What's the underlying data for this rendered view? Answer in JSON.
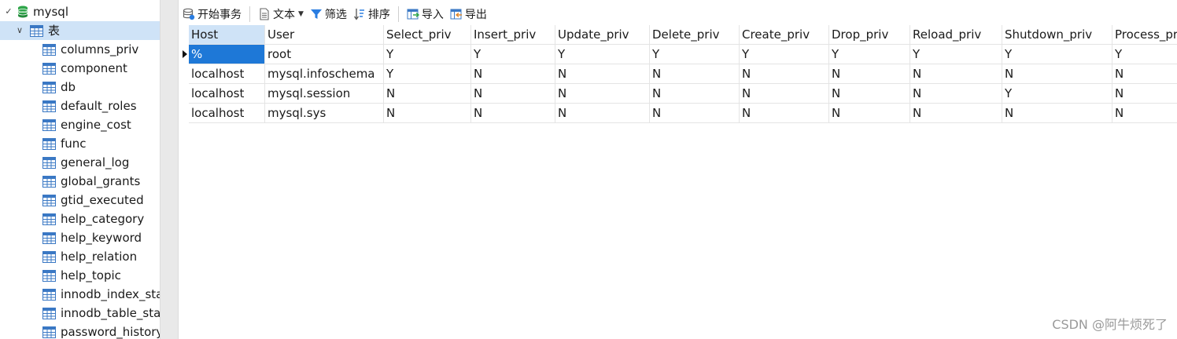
{
  "sidebar": {
    "database": "mysql",
    "tables_node": "表",
    "tables": [
      "columns_priv",
      "component",
      "db",
      "default_roles",
      "engine_cost",
      "func",
      "general_log",
      "global_grants",
      "gtid_executed",
      "help_category",
      "help_keyword",
      "help_relation",
      "help_topic",
      "innodb_index_sta",
      "innodb_table_sta",
      "password_history"
    ]
  },
  "toolbar": {
    "begin_transaction": "开始事务",
    "text": "文本",
    "filter": "筛选",
    "sort": "排序",
    "import": "导入",
    "export": "导出"
  },
  "grid": {
    "columns": [
      "Host",
      "User",
      "Select_priv",
      "Insert_priv",
      "Update_priv",
      "Delete_priv",
      "Create_priv",
      "Drop_priv",
      "Reload_priv",
      "Shutdown_priv",
      "Process_pr"
    ],
    "rows": [
      [
        "%",
        "root",
        "Y",
        "Y",
        "Y",
        "Y",
        "Y",
        "Y",
        "Y",
        "Y",
        "Y"
      ],
      [
        "localhost",
        "mysql.infoschema",
        "Y",
        "N",
        "N",
        "N",
        "N",
        "N",
        "N",
        "N",
        "N"
      ],
      [
        "localhost",
        "mysql.session",
        "N",
        "N",
        "N",
        "N",
        "N",
        "N",
        "N",
        "Y",
        "N"
      ],
      [
        "localhost",
        "mysql.sys",
        "N",
        "N",
        "N",
        "N",
        "N",
        "N",
        "N",
        "N",
        "N"
      ]
    ]
  },
  "watermark": "CSDN @阿牛烦死了",
  "colors": {
    "selection": "#1e78d7",
    "header_active": "#cfe3f7",
    "db_icon": "#2fa64a",
    "table_icon": "#3a78c4"
  },
  "icons": [
    "database-icon",
    "table-icon",
    "transaction-icon",
    "text-icon",
    "filter-icon",
    "sort-icon",
    "import-icon",
    "export-icon"
  ]
}
